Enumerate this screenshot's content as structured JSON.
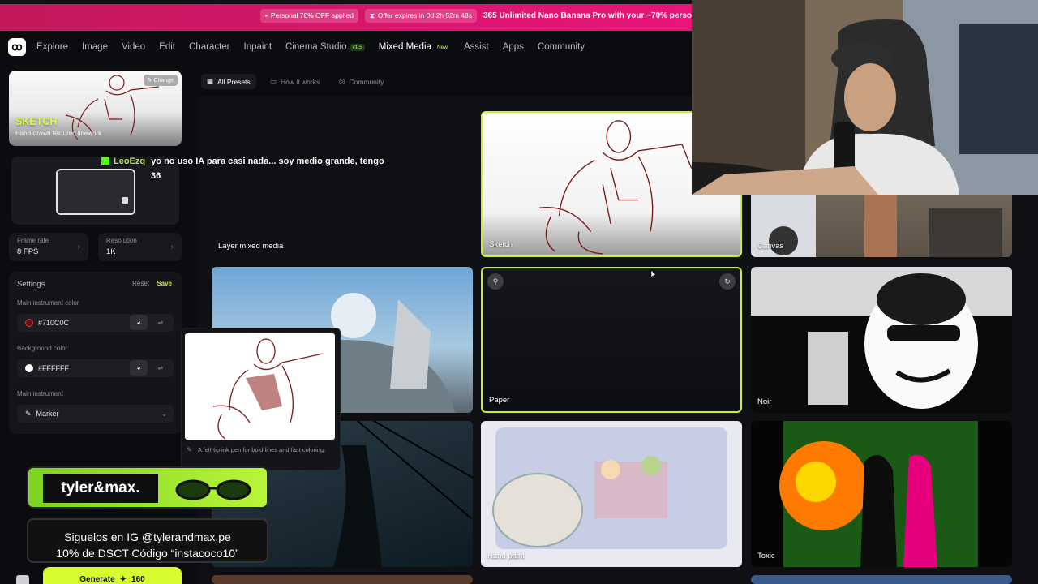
{
  "promo": {
    "pill1": "Personal 70% OFF applied",
    "pill2": "Offer expires in 0d 2h 52m 48s",
    "main": "365 Unlimited Nano Banana Pro with your ~70% perso"
  },
  "nav": {
    "items": [
      "Explore",
      "Image",
      "Video",
      "Edit",
      "Character",
      "Inpaint",
      "Cinema Studio",
      "Mixed Media",
      "Assist",
      "Apps",
      "Community"
    ],
    "cinema_tag": "v1.5",
    "mixed_tag": "New"
  },
  "sidebar": {
    "preset_title": "SKETCH",
    "preset_sub": "Hand-drawn textured linework",
    "change_label": "Change",
    "frame_rate_label": "Frame rate",
    "frame_rate_value": "8 FPS",
    "resolution_label": "Resolution",
    "resolution_value": "1K",
    "settings_label": "Settings",
    "reset_label": "Reset",
    "save_label": "Save",
    "main_color_label": "Main instrument color",
    "main_color_value": "#710C0C",
    "bg_color_label": "Background color",
    "bg_color_value": "#FFFFFF",
    "instrument_label": "Main instrument",
    "instrument_value": "Marker",
    "generate_label": "Generate",
    "generate_cost": "160"
  },
  "tabs": [
    "All Presets",
    "How it works",
    "Community"
  ],
  "cards": [
    "Layer mixed media",
    "Sketch",
    "Canvas",
    "Paper",
    "Noir",
    "Hand paint",
    "Toxic"
  ],
  "popover": {
    "desc": "A felt-tip ink pen for bold lines and fast coloring."
  },
  "chat": {
    "user": "LeoEzq",
    "msg": "yo no uso IA para casi nada... soy medio grande, tengo",
    "msg2": "36"
  },
  "sponsor": {
    "brand": "tyler&max.",
    "line1": "Siguelos en IG @tylerandmax.pe",
    "line2": "10% de DSCT Código “instacoco10”"
  },
  "colors": {
    "accent": "#c7ef3a",
    "promo": "#e8157a",
    "main_instrument": "#710C0C",
    "background": "#FFFFFF"
  },
  "icons": [
    "logo-icon",
    "grid-icon",
    "play-box-icon",
    "globe-icon",
    "pen-icon",
    "palette-icon",
    "sliders-icon",
    "chevron-down-icon",
    "pin-icon",
    "refresh-icon",
    "sparkle-icon"
  ]
}
